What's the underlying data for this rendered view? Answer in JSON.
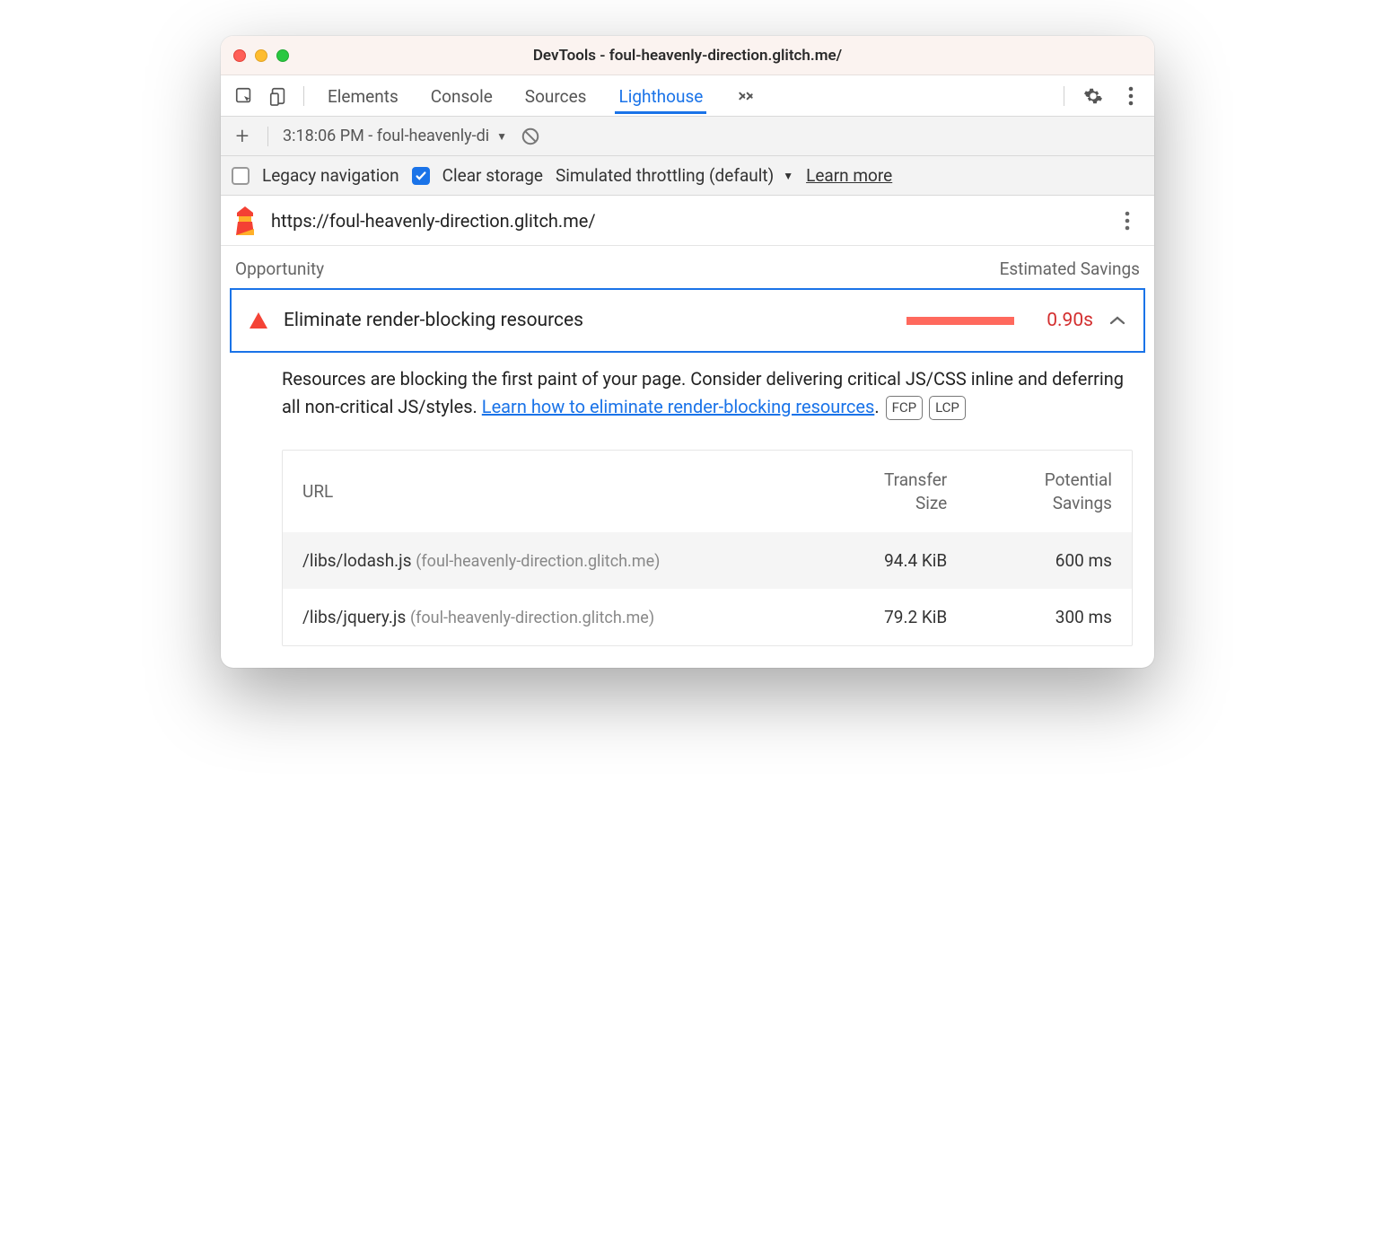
{
  "window": {
    "title": "DevTools - foul-heavenly-direction.glitch.me/"
  },
  "tabs": {
    "items": [
      "Elements",
      "Console",
      "Sources",
      "Lighthouse"
    ],
    "active": "Lighthouse"
  },
  "toolbar": {
    "run_label": "3:18:06 PM - foul-heavenly-di"
  },
  "options": {
    "legacy_label": "Legacy navigation",
    "legacy_checked": false,
    "clear_label": "Clear storage",
    "clear_checked": true,
    "throttling_label": "Simulated throttling (default)",
    "learn_more": "Learn more"
  },
  "url_bar": {
    "url": "https://foul-heavenly-direction.glitch.me/"
  },
  "section": {
    "left": "Opportunity",
    "right": "Estimated Savings"
  },
  "audit": {
    "title": "Eliminate render-blocking resources",
    "savings": "0.90s",
    "description_pre": "Resources are blocking the first paint of your page. Consider delivering critical JS/CSS inline and deferring all non-critical JS/styles. ",
    "link_text": "Learn how to eliminate render-blocking resources",
    "description_post": ".",
    "pill1": "FCP",
    "pill2": "LCP"
  },
  "table": {
    "headers": {
      "url": "URL",
      "size1": "Transfer",
      "size2": "Size",
      "save1": "Potential",
      "save2": "Savings"
    },
    "rows": [
      {
        "path": "/libs/lodash.js",
        "host": "(foul-heavenly-direction.glitch.me)",
        "size": "94.4 KiB",
        "savings": "600 ms"
      },
      {
        "path": "/libs/jquery.js",
        "host": "(foul-heavenly-direction.glitch.me)",
        "size": "79.2 KiB",
        "savings": "300 ms"
      }
    ]
  }
}
